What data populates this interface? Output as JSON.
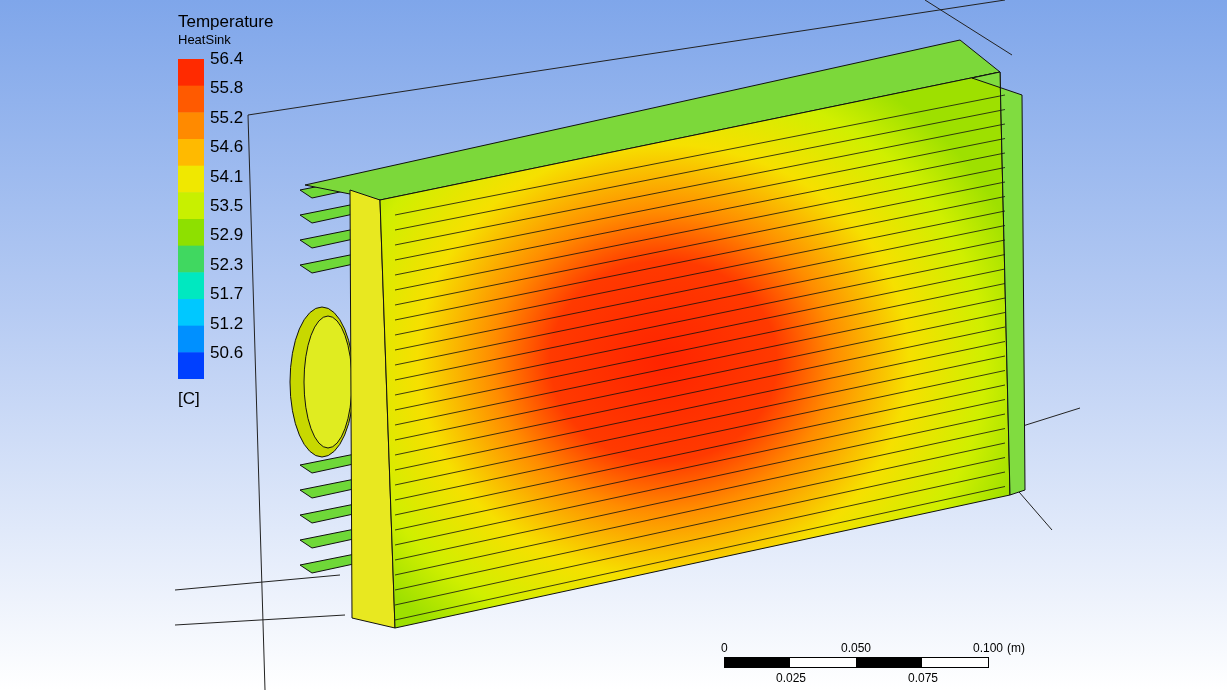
{
  "legend": {
    "title": "Temperature",
    "subtitle": "HeatSink",
    "labels": [
      "56.4",
      "55.8",
      "55.2",
      "54.6",
      "54.1",
      "53.5",
      "52.9",
      "52.3",
      "51.7",
      "51.2",
      "50.6"
    ],
    "unit": "[C]"
  },
  "scale_bar": {
    "top_labels": [
      "0",
      "0.050",
      "0.100"
    ],
    "unit": "(m)",
    "bottom_labels": [
      "0.025",
      "0.075"
    ]
  }
}
